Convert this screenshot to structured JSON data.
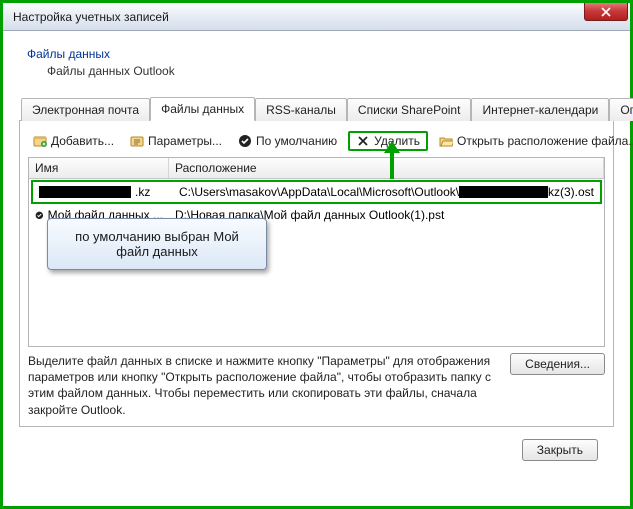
{
  "window": {
    "title": "Настройка учетных записей"
  },
  "header": {
    "title": "Файлы данных",
    "subtitle": "Файлы данных Outlook"
  },
  "tabs": [
    "Электронная почта",
    "Файлы данных",
    "RSS-каналы",
    "Списки SharePoint",
    "Интернет-календари",
    "Опублико"
  ],
  "active_tab_index": 1,
  "toolbar": {
    "add": "Добавить...",
    "settings": "Параметры...",
    "default": "По умолчанию",
    "remove": "Удалить",
    "open_location": "Открыть расположение файла..."
  },
  "table": {
    "columns": {
      "name": "Имя",
      "location": "Расположение"
    },
    "rows": [
      {
        "name_suffix": ".kz",
        "location_prefix": "C:\\Users\\masakov\\AppData\\Local\\Microsoft\\Outlook\\",
        "location_suffix": "kz(3).ost",
        "default": false,
        "highlighted": true,
        "redacted": true
      },
      {
        "name": "Мой файл данных ...",
        "location": "D:\\Новая папка\\Мой файл данных Outlook(1).pst",
        "default": true,
        "highlighted": false,
        "redacted": false
      }
    ]
  },
  "tooltip": "по умолчанию выбран Мой файл данных",
  "footer_text": "Выделите файл данных в списке и нажмите кнопку \"Параметры\" для отображения параметров или кнопку \"Открыть расположение файла\", чтобы отобразить папку с этим файлом данных. Чтобы переместить или скопировать эти файлы, сначала закройте Outlook.",
  "buttons": {
    "details": "Сведения...",
    "close": "Закрыть"
  }
}
